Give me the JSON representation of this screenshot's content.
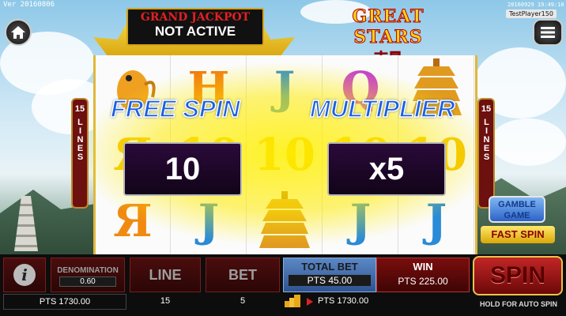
{
  "top": {
    "version": "Ver 20160806",
    "clock": "20160929 19:49:10",
    "player": "TestPlayer150"
  },
  "jackpot": {
    "title": "GRAND JACKPOT",
    "status": "NOT ACTIVE"
  },
  "logo": {
    "title": "GREAT STARS",
    "subtitle": "吉星"
  },
  "lines_indicator": {
    "number": "15",
    "word": "LINES"
  },
  "bonus": {
    "free_spin_label": "FREE SPIN",
    "free_spin_value": "10",
    "multiplier_label": "MULTIPLIER",
    "multiplier_value": "x5"
  },
  "reels": [
    [
      "koi-fish",
      "Я",
      "Я"
    ],
    [
      "H",
      "10",
      "J"
    ],
    [
      "J",
      "10",
      "pagoda"
    ],
    [
      "Q",
      "10",
      "J"
    ],
    [
      "pagoda",
      "10",
      "J"
    ]
  ],
  "side_buttons": {
    "gamble": "GAMBLE GAME",
    "fast_spin": "FAST SPIN"
  },
  "bottom": {
    "info_icon": "i",
    "denomination_label": "DENOMINATION",
    "denomination_value": "0.60",
    "line_label": "LINE",
    "line_value": "15",
    "bet_label": "BET",
    "bet_value": "5",
    "total_bet_label": "TOTAL BET",
    "total_bet_value": "PTS 45.00",
    "win_label": "WIN",
    "win_value": "PTS 225.00",
    "balance_left": "PTS 1730.00",
    "balance_right": "PTS 1730.00",
    "spin_label": "SPIN",
    "autospin_hint": "HOLD FOR AUTO SPIN"
  },
  "colors": {
    "accent_blue": "#1b5fe0",
    "gold": "#e0b73a",
    "panel_red": "#4a0d0d",
    "jackpot_red": "#e32020"
  }
}
